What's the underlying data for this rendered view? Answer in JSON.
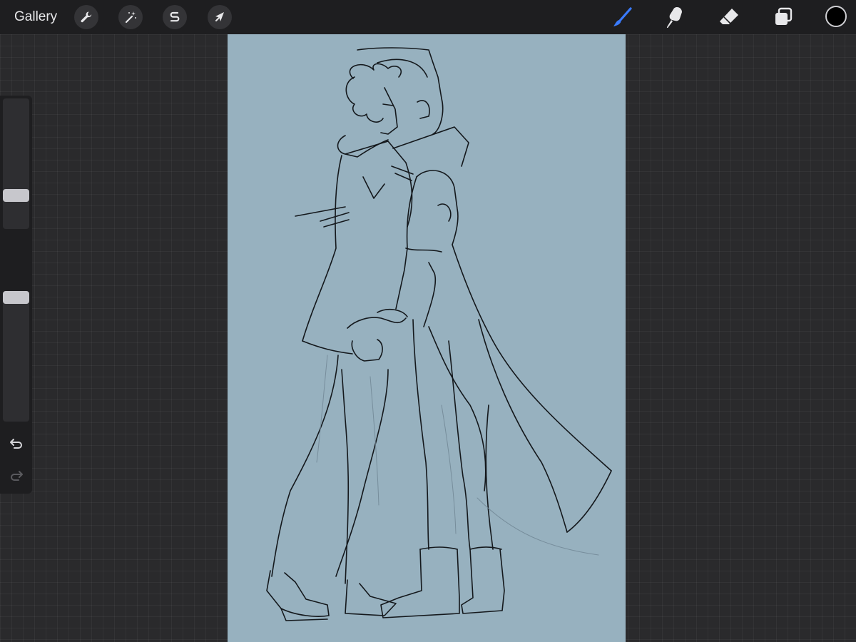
{
  "app": {
    "gallery_label": "Gallery"
  },
  "toolbar": {
    "left_tools": [
      {
        "name": "actions",
        "icon": "wrench-icon"
      },
      {
        "name": "adjustments",
        "icon": "magic-wand-icon"
      },
      {
        "name": "selection",
        "icon": "selection-s-icon"
      },
      {
        "name": "transform",
        "icon": "arrow-cursor-icon"
      }
    ],
    "right_tools": [
      {
        "name": "brush",
        "icon": "brush-icon",
        "active": true
      },
      {
        "name": "smudge",
        "icon": "smudge-finger-icon",
        "active": false
      },
      {
        "name": "eraser",
        "icon": "eraser-icon",
        "active": false
      },
      {
        "name": "layers",
        "icon": "layers-icon",
        "active": false
      }
    ],
    "current_color": "#000000"
  },
  "sidebar": {
    "brush_size_level": 0.23,
    "opacity_level": 1.0,
    "undo_icon": "undo-icon",
    "redo_icon": "redo-icon"
  },
  "colors": {
    "canvas_background": "#97b1bf",
    "accent_blue": "#3a7bff",
    "ui_background": "#1e1e20",
    "workspace": "#2a2a2c",
    "line_color": "#14181c"
  }
}
